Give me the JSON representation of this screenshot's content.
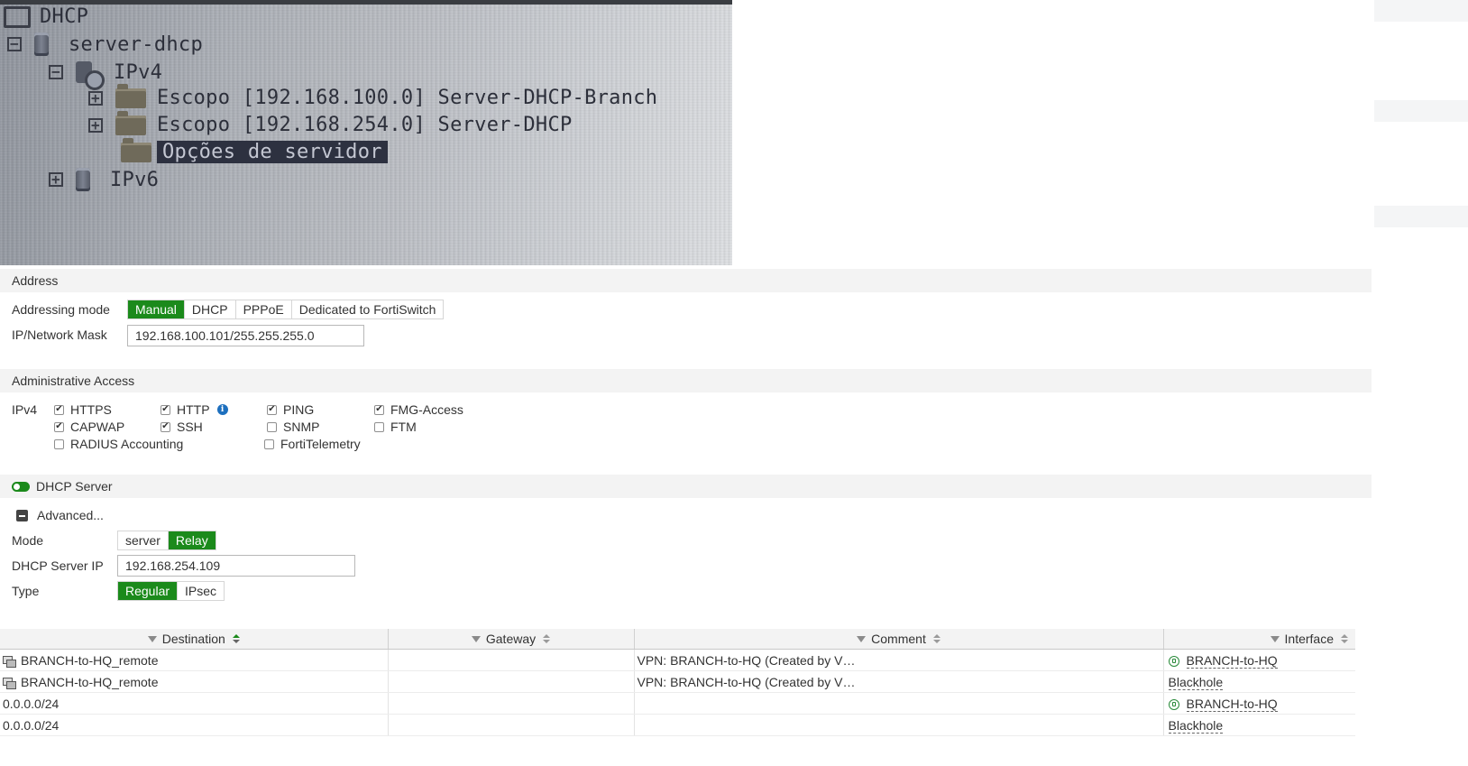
{
  "photo": {
    "title": "DHCP",
    "server": "server-dhcp",
    "ipv4": "IPv4",
    "scope1": "Escopo [192.168.100.0] Server-DHCP-Branch",
    "scope2": "Escopo [192.168.254.0] Server-DHCP",
    "options": "Opções de servidor",
    "ipv6": "IPv6"
  },
  "address": {
    "section": "Address",
    "mode_label": "Addressing mode",
    "modes": [
      "Manual",
      "DHCP",
      "PPPoE",
      "Dedicated to FortiSwitch"
    ],
    "mode_selected": "Manual",
    "ip_label": "IP/Network Mask",
    "ip_value": "192.168.100.101/255.255.255.0"
  },
  "admin": {
    "section": "Administrative Access",
    "ipv4_label": "IPv4",
    "items": [
      {
        "label": "HTTPS",
        "checked": true
      },
      {
        "label": "HTTP",
        "checked": true
      },
      {
        "label": "PING",
        "checked": true
      },
      {
        "label": "FMG-Access",
        "checked": true
      },
      {
        "label": "CAPWAP",
        "checked": true
      },
      {
        "label": "SSH",
        "checked": true
      },
      {
        "label": "SNMP",
        "checked": false
      },
      {
        "label": "FTM",
        "checked": false
      },
      {
        "label": "RADIUS Accounting",
        "checked": false
      },
      {
        "label": "FortiTelemetry",
        "checked": false
      }
    ]
  },
  "dhcp": {
    "section": "DHCP Server",
    "enabled": true,
    "advanced": "Advanced...",
    "mode_label": "Mode",
    "modes": [
      "server",
      "Relay"
    ],
    "mode_selected": "Relay",
    "server_ip_label": "DHCP Server IP",
    "server_ip": "192.168.254.109",
    "type_label": "Type",
    "types": [
      "Regular",
      "IPsec"
    ],
    "type_selected": "Regular"
  },
  "table": {
    "columns": [
      "Destination",
      "Gateway",
      "Comment",
      "Interface"
    ],
    "rows": [
      {
        "destination": "BRANCH-to-HQ_remote",
        "gateway": "",
        "comment": "VPN: BRANCH-to-HQ (Created by V…",
        "interface": "BRANCH-to-HQ"
      },
      {
        "destination": "BRANCH-to-HQ_remote",
        "gateway": "",
        "comment": "VPN: BRANCH-to-HQ (Created by V…",
        "interface": "Blackhole"
      },
      {
        "destination": "0.0.0.0/24",
        "gateway": "",
        "comment": "",
        "interface": "BRANCH-to-HQ"
      },
      {
        "destination": "0.0.0.0/24",
        "gateway": "",
        "comment": "",
        "interface": "Blackhole"
      }
    ]
  },
  "colors": {
    "accent": "#1b8a1b",
    "header_bg": "#f3f3f3",
    "info": "#1d6fbe"
  }
}
